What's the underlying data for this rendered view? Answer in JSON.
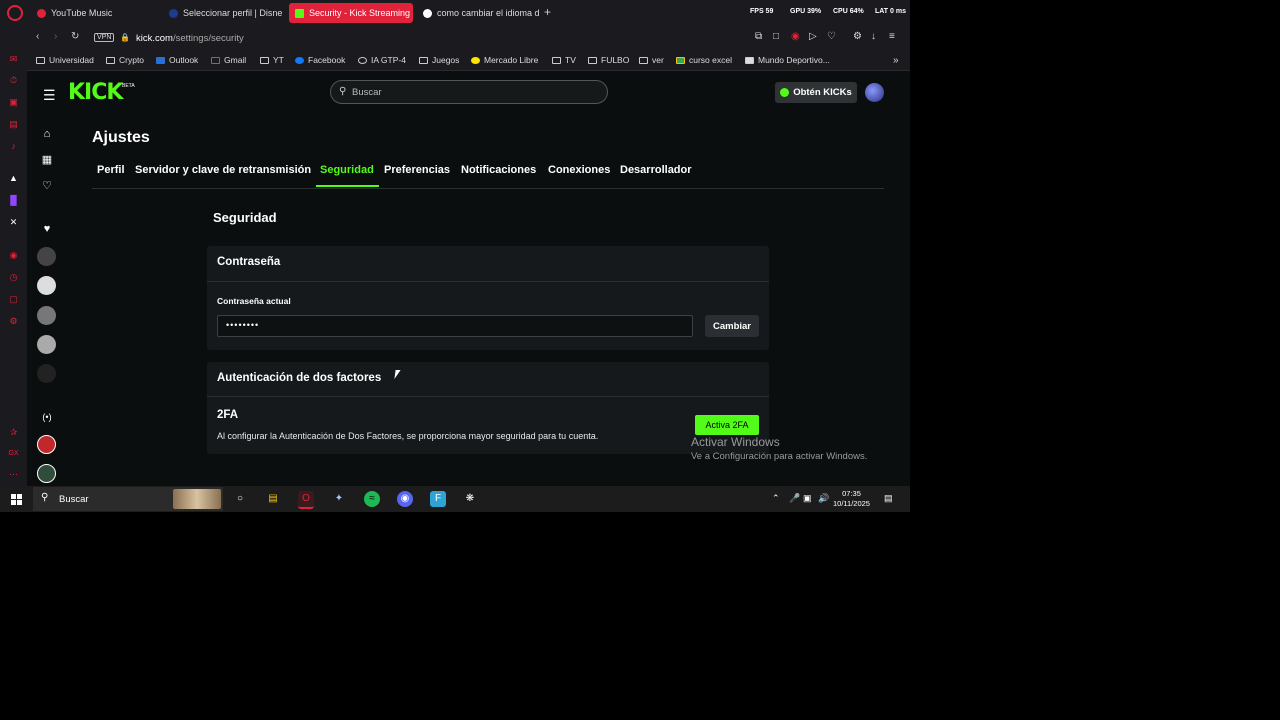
{
  "browser": {
    "tabs": [
      {
        "label": "YouTube Music",
        "icon": "youtube-music-icon",
        "active": false
      },
      {
        "label": "Seleccionar perfil | Disne",
        "icon": "disney-icon",
        "active": false
      },
      {
        "label": "Security - Kick Streaming",
        "icon": "kick-icon",
        "active": true
      },
      {
        "label": "como cambiar el idioma d",
        "icon": "google-icon",
        "active": false
      }
    ],
    "new_tab": "+",
    "stats": {
      "fps": "FPS 59",
      "gpu": "GPU 39%",
      "cpu": "CPU 64%",
      "lat": "LAT 0 ms"
    },
    "vpn": "VPN",
    "url_host": "kick.com",
    "url_path": "/settings/security",
    "bookmarks": [
      {
        "label": "Universidad",
        "icon": "folder-icon"
      },
      {
        "label": "Crypto",
        "icon": "folder-icon"
      },
      {
        "label": "Outlook",
        "icon": "outlook-icon"
      },
      {
        "label": "Gmail",
        "icon": "gmail-icon"
      },
      {
        "label": "YT",
        "icon": "folder-icon"
      },
      {
        "label": "Facebook",
        "icon": "facebook-icon"
      },
      {
        "label": "IA GTP-4",
        "icon": "openai-icon"
      },
      {
        "label": "Juegos",
        "icon": "folder-icon"
      },
      {
        "label": "Mercado Libre",
        "icon": "mercadolibre-icon"
      },
      {
        "label": "TV",
        "icon": "folder-icon"
      },
      {
        "label": "FULBO",
        "icon": "folder-icon"
      },
      {
        "label": "ver",
        "icon": "folder-icon"
      },
      {
        "label": "curso excel",
        "icon": "drive-icon"
      },
      {
        "label": "Mundo Deportivo...",
        "icon": "news-icon"
      }
    ]
  },
  "header": {
    "logo": "KICK",
    "beta": "BETA",
    "search_placeholder": "Buscar",
    "kicks_button": "Obtén KICKs"
  },
  "settings": {
    "title": "Ajustes",
    "tabs": [
      "Perfil",
      "Servidor y clave de retransmisión",
      "Seguridad",
      "Preferencias",
      "Notificaciones",
      "Conexiones",
      "Desarrollador"
    ],
    "active_tab": "Seguridad",
    "section_title": "Seguridad",
    "password": {
      "heading": "Contraseña",
      "label": "Contraseña actual",
      "value": "••••••••",
      "button": "Cambiar"
    },
    "twofa": {
      "heading": "Autenticación de dos factores",
      "title": "2FA",
      "description": "Al configurar la Autenticación de Dos Factores, se proporciona mayor seguridad para tu cuenta.",
      "button": "Activa 2FA"
    }
  },
  "watermark": {
    "title": "Activar Windows",
    "subtitle": "Ve a Configuración para activar Windows."
  },
  "taskbar": {
    "search": "Buscar",
    "time": "07:35",
    "date": "10/11/2025"
  },
  "colors": {
    "accent": "#53fc18",
    "opera_red": "#e0223b",
    "background": "#0b0e0f",
    "card": "#15191b"
  }
}
